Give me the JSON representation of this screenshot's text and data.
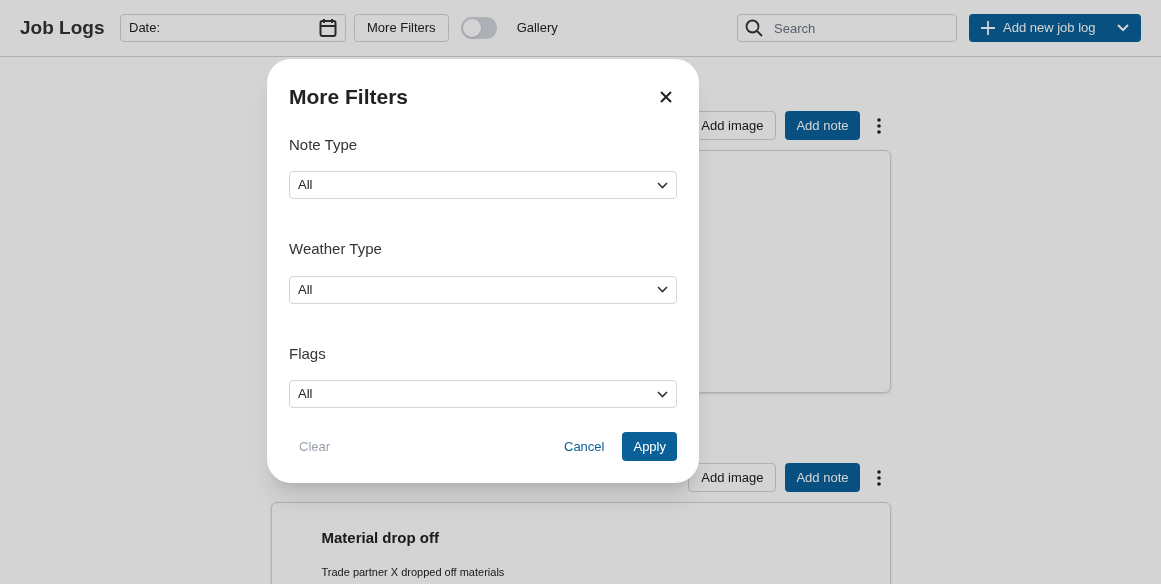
{
  "header": {
    "title": "Job Logs",
    "date_field": {
      "label": "Date:"
    },
    "more_filters_button": "More Filters",
    "gallery_toggle": {
      "label": "Gallery",
      "on": false
    },
    "search": {
      "placeholder": "Search"
    },
    "add_button": "Add new job log"
  },
  "logs": [
    {
      "add_image": "Add image",
      "add_note": "Add note"
    },
    {
      "add_image": "Add image",
      "add_note": "Add note",
      "title": "Material drop off",
      "text": "Trade partner X dropped off materials"
    }
  ],
  "modal": {
    "title": "More Filters",
    "filters": [
      {
        "label": "Note Type",
        "value": "All"
      },
      {
        "label": "Weather Type",
        "value": "All"
      },
      {
        "label": "Flags",
        "value": "All"
      }
    ],
    "clear": {
      "label": "Clear",
      "disabled": true
    },
    "cancel": "Cancel",
    "apply": "Apply"
  }
}
